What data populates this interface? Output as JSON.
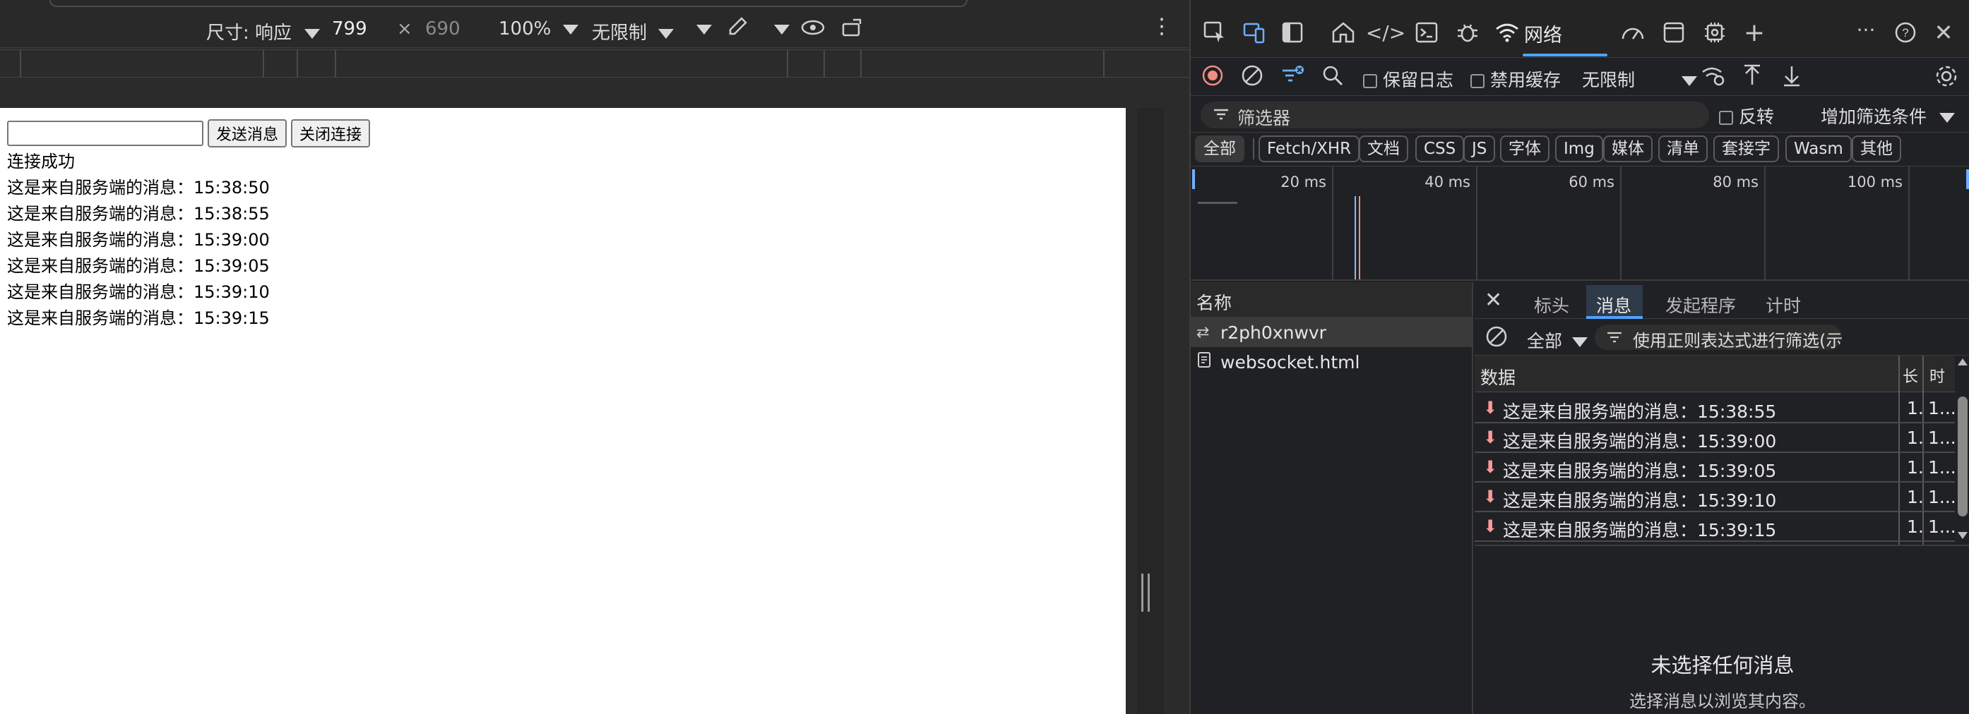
{
  "device_toolbar": {
    "dimensions_label": "尺寸: 响应",
    "width": "799",
    "times": "×",
    "height": "690",
    "zoom": "100%",
    "throttle": "无限制"
  },
  "page": {
    "input_value": "",
    "send_button": "发送消息",
    "close_button": "关闭连接",
    "log": [
      "连接成功",
      "这是来自服务端的消息：15:38:50",
      "这是来自服务端的消息：15:38:55",
      "这是来自服务端的消息：15:39:00",
      "这是来自服务端的消息：15:39:05",
      "这是来自服务端的消息：15:39:10",
      "这是来自服务端的消息：15:39:15"
    ]
  },
  "devtools": {
    "tabs": {
      "network_label": "网络",
      "icons": [
        "inspect-icon",
        "device-toggle-icon",
        "dock-icon",
        "home-icon",
        "elements-icon",
        "console-icon",
        "bug-icon",
        "wifi-icon",
        "performance-icon",
        "application-icon",
        "settings-icon",
        "add-tool-icon",
        "more-icon",
        "help-icon",
        "close-icon"
      ]
    },
    "network_toolbar": {
      "preserve_log": "保留日志",
      "disable_cache": "禁用缓存",
      "throttle": "无限制"
    },
    "filter": {
      "placeholder": "筛选器",
      "invert": "反转",
      "more_filters": "增加筛选条件"
    },
    "types": [
      "全部",
      "Fetch/XHR",
      "文档",
      "CSS",
      "JS",
      "字体",
      "Img",
      "媒体",
      "清单",
      "套接字",
      "Wasm",
      "其他"
    ],
    "active_type": "全部",
    "timeline_labels": [
      "20 ms",
      "40 ms",
      "60 ms",
      "80 ms",
      "100 ms"
    ],
    "names_header": "名称",
    "requests": [
      {
        "name": "r2ph0xnwvr",
        "icon": "websocket-icon",
        "selected": true
      },
      {
        "name": "websocket.html",
        "icon": "document-icon",
        "selected": false
      }
    ],
    "detail_tabs": [
      "标头",
      "消息",
      "发起程序",
      "计时"
    ],
    "active_detail_tab": "消息",
    "message_filter": {
      "scope": "全部",
      "regex_placeholder": "使用正则表达式进行筛选(示"
    },
    "messages_header": {
      "data": "数据",
      "col2": "长",
      "col3": "时"
    },
    "messages": [
      {
        "text": "这是来自服务端的消息：15:38:55",
        "c2": "1.",
        "c3": "1..."
      },
      {
        "text": "这是来自服务端的消息：15:39:00",
        "c2": "1.",
        "c3": "1..."
      },
      {
        "text": "这是来自服务端的消息：15:39:05",
        "c2": "1.",
        "c3": "1..."
      },
      {
        "text": "这是来自服务端的消息：15:39:10",
        "c2": "1.",
        "c3": "1..."
      },
      {
        "text": "这是来自服务端的消息：15:39:15",
        "c2": "1.",
        "c3": "1..."
      }
    ],
    "empty_state": {
      "title": "未选择任何消息",
      "subtitle": "选择消息以浏览其内容。"
    }
  }
}
